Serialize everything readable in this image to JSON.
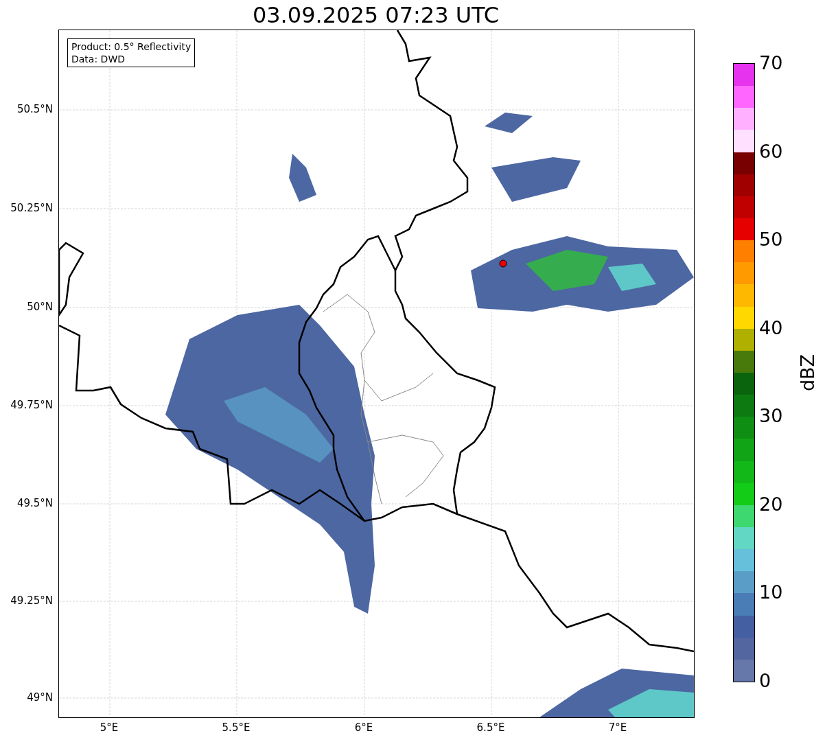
{
  "title": "03.09.2025 07:23 UTC",
  "info_box": {
    "lines": [
      "Product: 0.5° Reflectivity",
      "Data: DWD"
    ]
  },
  "map": {
    "y_ticks": [
      "50.5°N",
      "50.25°N",
      "50°N",
      "49.75°N",
      "49.5°N",
      "49.25°N",
      "49°N"
    ],
    "x_ticks": [
      "5°E",
      "5.5°E",
      "6°E",
      "6.5°E",
      "7°E"
    ]
  },
  "colorbar": {
    "label": "dBZ",
    "ticks": [
      "70",
      "60",
      "50",
      "40",
      "30",
      "20",
      "10",
      "0"
    ],
    "segments": [
      {
        "color": "#e633ee"
      },
      {
        "color": "#ff66ff"
      },
      {
        "color": "#ffb0ff"
      },
      {
        "color": "#ffe0ff"
      },
      {
        "color": "#780000"
      },
      {
        "color": "#a00000"
      },
      {
        "color": "#c00000"
      },
      {
        "color": "#e60000"
      },
      {
        "color": "#ff7f00"
      },
      {
        "color": "#ff9a00"
      },
      {
        "color": "#ffb800"
      },
      {
        "color": "#ffd800"
      },
      {
        "color": "#b0b000"
      },
      {
        "color": "#477a0a"
      },
      {
        "color": "#0a640e"
      },
      {
        "color": "#0c7a10"
      },
      {
        "color": "#0e8e12"
      },
      {
        "color": "#10a416"
      },
      {
        "color": "#12b818"
      },
      {
        "color": "#12cc18"
      },
      {
        "color": "#3ed870"
      },
      {
        "color": "#62d8c4"
      },
      {
        "color": "#66c0dc"
      },
      {
        "color": "#5a9ec8"
      },
      {
        "color": "#4a7cb6"
      },
      {
        "color": "#455fa3"
      },
      {
        "color": "#5466a0"
      },
      {
        "color": "#6677aa"
      }
    ]
  }
}
